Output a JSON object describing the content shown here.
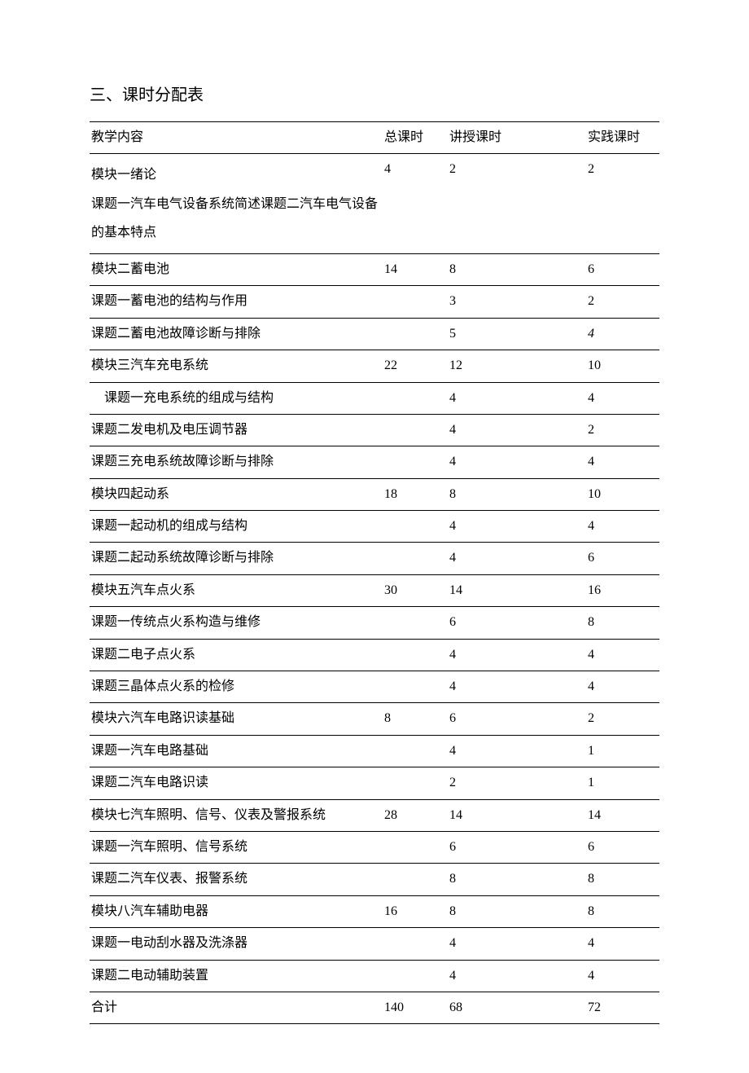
{
  "heading": "三、课时分配表",
  "headers": {
    "content": "教学内容",
    "total": "总课时",
    "lecture": "讲授课时",
    "practice": "实践课时"
  },
  "sections": [
    {
      "module_row": {
        "content": "模块一绪论\n课题一汽车电气设备系统简述课题二汽车电气设备的基本特点",
        "total": "4",
        "lecture": "2",
        "practice": "2",
        "multiline": true
      },
      "topics": []
    },
    {
      "module_row": {
        "content": "模块二蓄电池",
        "total": "14",
        "lecture": "8",
        "practice": "6"
      },
      "topics": [
        {
          "content": "课题一蓄电池的结构与作用",
          "total": "",
          "lecture": "3",
          "practice": "2"
        },
        {
          "content": "课题二蓄电池故障诊断与排除",
          "total": "",
          "lecture": "5",
          "practice": "4",
          "practice_italic": true
        }
      ]
    },
    {
      "module_row": {
        "content": "模块三汽车充电系统",
        "total": "22",
        "lecture": "12",
        "practice": "10"
      },
      "topics": [
        {
          "content": "课题一充电系统的组成与结构",
          "total": "",
          "lecture": "4",
          "practice": "4",
          "indent": true
        },
        {
          "content": "课题二发电机及电压调节器",
          "total": "",
          "lecture": "4",
          "practice": "2"
        },
        {
          "content": "课题三充电系统故障诊断与排除",
          "total": "",
          "lecture": "4",
          "practice": "4"
        }
      ]
    },
    {
      "module_row": {
        "content": "模块四起动系",
        "total": "18",
        "lecture": "8",
        "practice": "10"
      },
      "topics": [
        {
          "content": "课题一起动机的组成与结构",
          "total": "",
          "lecture": "4",
          "practice": "4"
        },
        {
          "content": "课题二起动系统故障诊断与排除",
          "total": "",
          "lecture": "4",
          "practice": "6"
        }
      ]
    },
    {
      "module_row": {
        "content": "模块五汽车点火系",
        "total": "30",
        "lecture": "14",
        "practice": "16"
      },
      "topics": [
        {
          "content": "课题一传统点火系构造与维修",
          "total": "",
          "lecture": "6",
          "practice": "8"
        },
        {
          "content": "课题二电子点火系",
          "total": "",
          "lecture": "4",
          "practice": "4"
        },
        {
          "content": "课题三晶体点火系的检修",
          "total": "",
          "lecture": "4",
          "practice": "4"
        }
      ]
    },
    {
      "module_row": {
        "content": "模块六汽车电路识读基础",
        "total": "8",
        "lecture": "6",
        "practice": "2"
      },
      "topics": [
        {
          "content": "课题一汽车电路基础",
          "total": "",
          "lecture": "4",
          "practice": "1"
        },
        {
          "content": "课题二汽车电路识读",
          "total": "",
          "lecture": "2",
          "practice": "1"
        }
      ]
    },
    {
      "module_row": {
        "content": "模块七汽车照明、信号、仪表及警报系统",
        "total": "28",
        "lecture": "14",
        "practice": "14"
      },
      "topics": [
        {
          "content": "课题一汽车照明、信号系统",
          "total": "",
          "lecture": "6",
          "practice": "6"
        },
        {
          "content": "课题二汽车仪表、报警系统",
          "total": "",
          "lecture": "8",
          "practice": "8"
        }
      ]
    },
    {
      "module_row": {
        "content": "模块八汽车辅助电器",
        "total": "16",
        "lecture": "8",
        "practice": "8"
      },
      "topics": [
        {
          "content": "课题一电动刮水器及洗涤器",
          "total": "",
          "lecture": "4",
          "practice": "4"
        },
        {
          "content": "课题二电动辅助装置",
          "total": "",
          "lecture": "4",
          "practice": "4"
        }
      ]
    }
  ],
  "total_row": {
    "content": "合计",
    "total": "140",
    "lecture": "68",
    "practice": "72"
  }
}
